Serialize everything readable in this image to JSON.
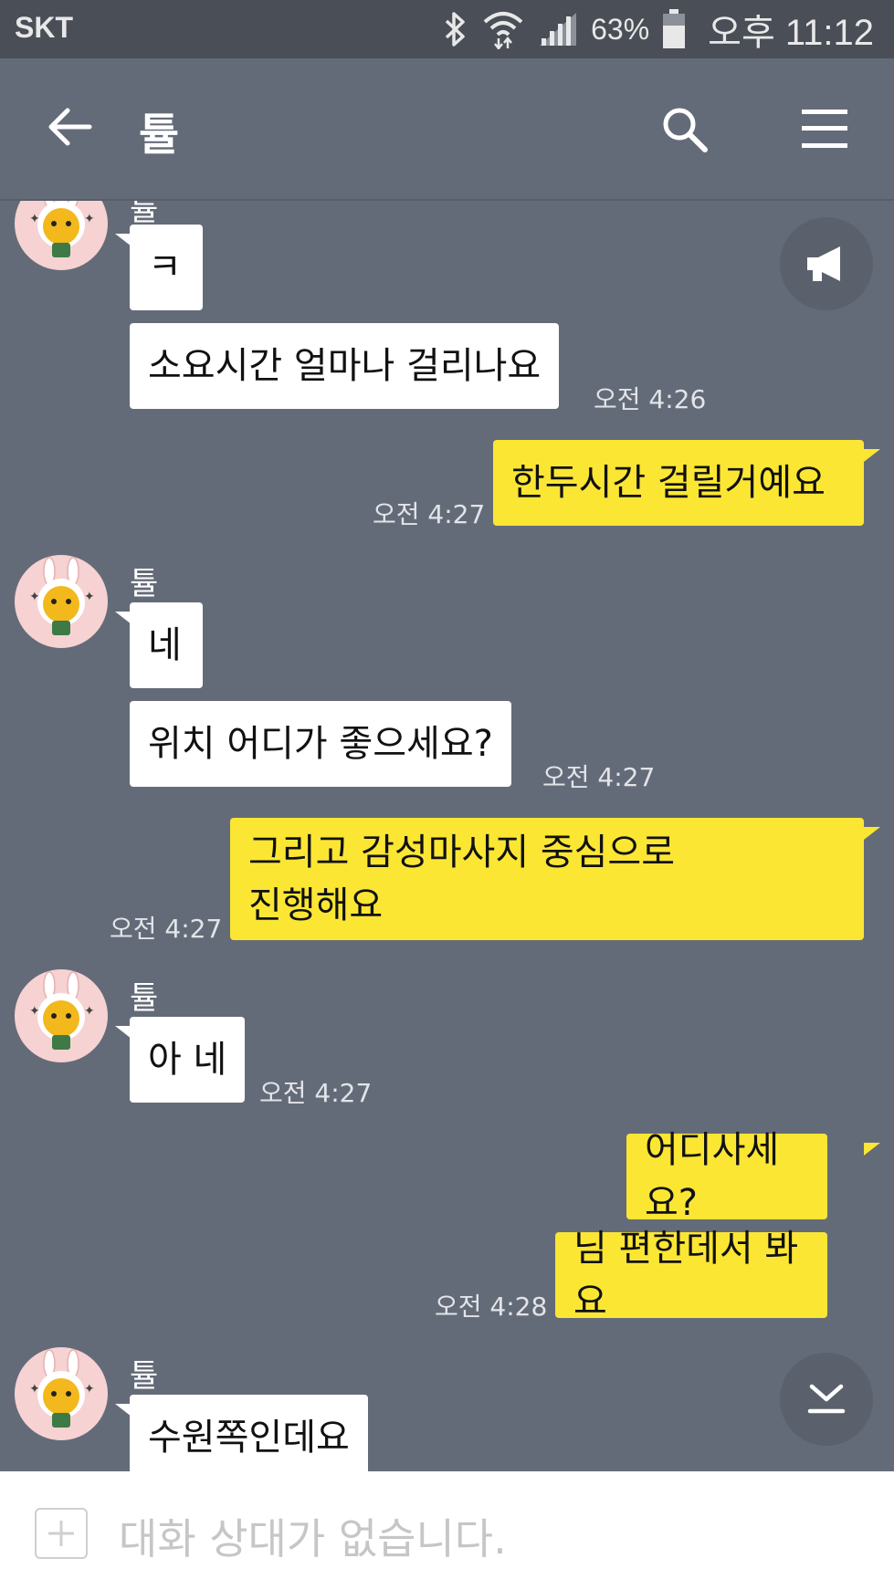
{
  "status_bar": {
    "carrier": "SKT",
    "battery": "63%",
    "time": "오후 11:12"
  },
  "header": {
    "title": "튤"
  },
  "messages": [
    {
      "from": "them",
      "text": "ㅋ"
    },
    {
      "from": "them",
      "text": "소요시간 얼마나 걸리나요",
      "time": "오전 4:26"
    },
    {
      "from": "me",
      "text": "한두시간 걸릴거예요",
      "time": "오전 4:27"
    },
    {
      "from": "them",
      "sender": "튤",
      "text": "네"
    },
    {
      "from": "them",
      "text": "위치 어디가 좋으세요?",
      "time": "오전 4:27"
    },
    {
      "from": "me",
      "text": "그리고 감성마사지 중심으로\n진행해요",
      "time": "오전 4:27"
    },
    {
      "from": "them",
      "sender": "튤",
      "text": "아 네",
      "time": "오전 4:27"
    },
    {
      "from": "me",
      "text": "어디사세요?"
    },
    {
      "from": "me",
      "text": "님 편한데서 봐요",
      "time": "오전 4:28"
    },
    {
      "from": "them",
      "sender": "튤",
      "text": "수원쪽인데요"
    }
  ],
  "input": {
    "placeholder": "대화 상대가 없습니다."
  },
  "icons": {
    "back": "arrow-left-icon",
    "search": "search-icon",
    "menu": "hamburger-icon",
    "notice": "megaphone-icon",
    "scroll_down": "scroll-to-bottom-icon",
    "add": "plus-icon"
  },
  "colors": {
    "background": "#646b78",
    "my_bubble": "#fbe634",
    "their_bubble": "#ffffff"
  }
}
